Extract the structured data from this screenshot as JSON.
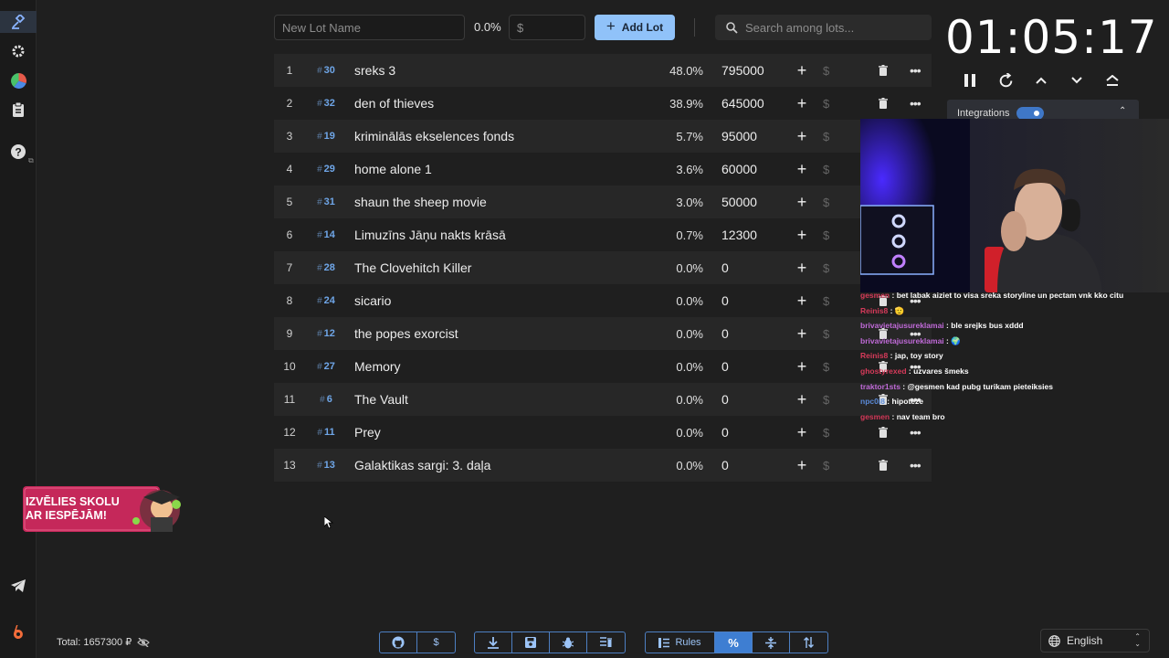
{
  "sidebar": {
    "items": [
      {
        "icon": "gavel-icon"
      },
      {
        "icon": "gear-icon"
      },
      {
        "icon": "pie-chart-icon"
      },
      {
        "icon": "clipboard-icon"
      },
      {
        "icon": "help-icon"
      }
    ],
    "bottom": [
      {
        "icon": "telegram-icon"
      },
      {
        "icon": "boosty-icon"
      }
    ]
  },
  "toolbar": {
    "new_lot_placeholder": "New Lot Name",
    "new_lot_percent": "0.0%",
    "amount_placeholder": "$",
    "add_lot_label": "Add Lot",
    "search_placeholder": "Search among lots..."
  },
  "lots": [
    {
      "num": "1",
      "id": "30",
      "name": "sreks 3",
      "percent": "48.0%",
      "amount": "795000"
    },
    {
      "num": "2",
      "id": "32",
      "name": "den of thieves",
      "percent": "38.9%",
      "amount": "645000"
    },
    {
      "num": "3",
      "id": "19",
      "name": "kriminālās ekselences fonds",
      "percent": "5.7%",
      "amount": "95000"
    },
    {
      "num": "4",
      "id": "29",
      "name": "home alone 1",
      "percent": "3.6%",
      "amount": "60000"
    },
    {
      "num": "5",
      "id": "31",
      "name": "shaun the sheep movie",
      "percent": "3.0%",
      "amount": "50000"
    },
    {
      "num": "6",
      "id": "14",
      "name": "Limuzīns Jāņu nakts krāsā",
      "percent": "0.7%",
      "amount": "12300"
    },
    {
      "num": "7",
      "id": "28",
      "name": "The Clovehitch Killer",
      "percent": "0.0%",
      "amount": "0"
    },
    {
      "num": "8",
      "id": "24",
      "name": "sicario",
      "percent": "0.0%",
      "amount": "0"
    },
    {
      "num": "9",
      "id": "12",
      "name": "the popes exorcist",
      "percent": "0.0%",
      "amount": "0"
    },
    {
      "num": "10",
      "id": "27",
      "name": "Memory",
      "percent": "0.0%",
      "amount": "0"
    },
    {
      "num": "11",
      "id": "6",
      "name": "The Vault",
      "percent": "0.0%",
      "amount": "0"
    },
    {
      "num": "12",
      "id": "11",
      "name": "Prey",
      "percent": "0.0%",
      "amount": "0"
    },
    {
      "num": "13",
      "id": "13",
      "name": "Galaktikas sargi: 3. daļa",
      "percent": "0.0%",
      "amount": "0"
    }
  ],
  "timer": {
    "time": "01:05:17"
  },
  "integrations": {
    "label": "Integrations",
    "enabled": true
  },
  "chat": [
    {
      "user": "gesmen",
      "color": "#d63a5a",
      "message": "bet labak aiziet to visa sreka storyline un pectam vnk kko citu"
    },
    {
      "user": "Reinis8",
      "color": "#d63a5a",
      "message": "🫡"
    },
    {
      "user": "brivavietajusureklamai",
      "color": "#c06ad8",
      "message": "ble srejks bus xddd"
    },
    {
      "user": "brivavietajusureklamai",
      "color": "#c06ad8",
      "message": "🌍"
    },
    {
      "user": "Reinis8",
      "color": "#d63a5a",
      "message": "jap, toy story"
    },
    {
      "user": "ghostyrexed",
      "color": "#d63a5a",
      "message": "uzvares šmeks"
    },
    {
      "user": "traktor1sts",
      "color": "#c06ad8",
      "message": "@gesmen kad pubg turikam pieteiksies"
    },
    {
      "user": "npc0i8",
      "color": "#5a8ad8",
      "message": "hipoteze"
    },
    {
      "user": "gesmen",
      "color": "#d63a5a",
      "message": "nav team bro"
    }
  ],
  "promo": {
    "line1": "IZVĒLIES SKOLU",
    "line2": "AR IESPĒJĀM!"
  },
  "footer": {
    "total_label": "Total: 1657300 ₽",
    "group1": [
      {
        "icon": "github-icon"
      },
      {
        "icon": "dollar-icon"
      }
    ],
    "group2": [
      {
        "icon": "download-icon"
      },
      {
        "icon": "save-icon"
      },
      {
        "icon": "bug-icon"
      },
      {
        "icon": "clear-list-icon"
      }
    ],
    "group3": [
      {
        "icon": "rules-icon",
        "label": "Rules"
      },
      {
        "icon": "percent-icon"
      },
      {
        "icon": "split-icon"
      },
      {
        "icon": "sort-icon"
      }
    ],
    "language": "English"
  },
  "colors": {
    "accent": "#90c2f9",
    "background": "#1f1f1f",
    "id_blue": "#6fa6e8"
  }
}
